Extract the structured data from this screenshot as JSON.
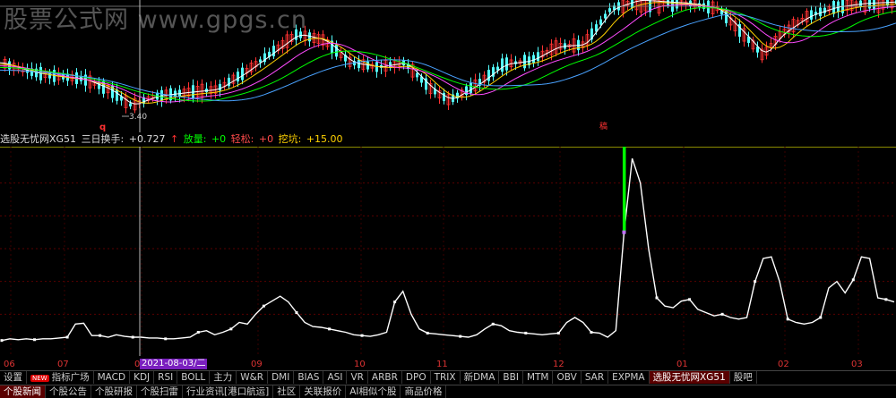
{
  "watermark": "股票公式网 www.gpgs.cn",
  "kline": {
    "low_marker": "3.40",
    "q_marker": "q",
    "red_marker": "稿"
  },
  "info_bar": {
    "name": "选股无忧网XG51",
    "turnover_label": "三日换手:",
    "turnover_value": "+0.727",
    "up_arrow": "↑",
    "volume_label": "放量:",
    "volume_value": "+0",
    "rise_label": "轻松:",
    "rise_value": "+0",
    "dig_label": "挖坑:",
    "dig_value": "+15.00"
  },
  "cursor_date": "2021-08-03/二",
  "months": [
    "06",
    "07",
    "08",
    "09",
    "10",
    "11",
    "12",
    "01",
    "02",
    "03"
  ],
  "tabs": [
    {
      "label": "设置"
    },
    {
      "label": "指标广场",
      "badge": "NEW"
    },
    {
      "label": "MACD"
    },
    {
      "label": "KDJ"
    },
    {
      "label": "RSI"
    },
    {
      "label": "BOLL"
    },
    {
      "label": "主力"
    },
    {
      "label": "W&R"
    },
    {
      "label": "DMI"
    },
    {
      "label": "BIAS"
    },
    {
      "label": "ASI"
    },
    {
      "label": "VR"
    },
    {
      "label": "ARBR"
    },
    {
      "label": "DPO"
    },
    {
      "label": "TRIX"
    },
    {
      "label": "新DMA"
    },
    {
      "label": "BBI"
    },
    {
      "label": "MTM"
    },
    {
      "label": "OBV"
    },
    {
      "label": "SAR"
    },
    {
      "label": "EXPMA"
    },
    {
      "label": "选股无忧网XG51",
      "active": true
    },
    {
      "label": "股吧"
    }
  ],
  "bottom_tabs": [
    {
      "label": "个股新闻",
      "active": true
    },
    {
      "label": "个股公告"
    },
    {
      "label": "个股研报"
    },
    {
      "label": "个股扫雷"
    },
    {
      "label": "行业资讯[港口航运]"
    },
    {
      "label": "社区"
    },
    {
      "label": "关联报价"
    },
    {
      "label": "AI相似个股"
    },
    {
      "label": "商品价格"
    }
  ],
  "colors": {
    "up": "#ff3232",
    "down": "#54ffff",
    "ma1": "#ffffff",
    "ma2": "#ffd200",
    "ma3": "#ff4bff",
    "ma4": "#00ff00",
    "ma5": "#49a2ff",
    "line": "#ffffff",
    "spike": "#00ff00"
  },
  "chart_data": {
    "type": "line",
    "series": [
      {
        "name": "选股无忧网XG51",
        "values": [
          8,
          10,
          9,
          10,
          9,
          10,
          10,
          11,
          12,
          28,
          29,
          14,
          14,
          12,
          15,
          13,
          12,
          12,
          11,
          11,
          10,
          10,
          11,
          12,
          18,
          20,
          15,
          18,
          22,
          30,
          28,
          40,
          50,
          56,
          62,
          55,
          42,
          30,
          25,
          24,
          22,
          20,
          18,
          15,
          14,
          13,
          15,
          18,
          55,
          68,
          40,
          22,
          17,
          16,
          15,
          14,
          13,
          12,
          15,
          22,
          28,
          26,
          20,
          18,
          17,
          16,
          15,
          16,
          17,
          30,
          36,
          30,
          18,
          17,
          12,
          20,
          140,
          230,
          200,
          120,
          60,
          50,
          48,
          56,
          58,
          46,
          42,
          38,
          40,
          36,
          34,
          36,
          80,
          108,
          110,
          80,
          34,
          30,
          28,
          30,
          36,
          72,
          80,
          66,
          82,
          110,
          108,
          60,
          58,
          55
        ]
      }
    ]
  }
}
